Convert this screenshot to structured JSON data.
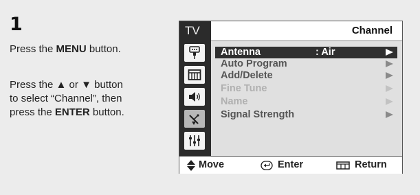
{
  "step": {
    "number": "1",
    "line1": {
      "pre": "Press the ",
      "bold": "MENU",
      "post": " button."
    },
    "block2": {
      "line1_pre": "Press the ",
      "up_arrow": "▲",
      "or": " or ",
      "down_arrow": "▼",
      "line1_post": " button",
      "line2": "to select “Channel”, then",
      "line3_pre": "press the ",
      "line3_bold": "ENTER",
      "line3_post": " button."
    }
  },
  "osd": {
    "side_title": "TV",
    "side_icons": [
      "input-icon",
      "picture-icon",
      "sound-icon",
      "channel-icon",
      "setup-icon"
    ],
    "active_side_icon": "channel-icon",
    "header_title": "Channel",
    "menu_items": [
      {
        "label": "Antenna",
        "value": ": Air",
        "state": "selected"
      },
      {
        "label": "Auto Program",
        "value": "",
        "state": "normal"
      },
      {
        "label": "Add/Delete",
        "value": "",
        "state": "normal"
      },
      {
        "label": "Fine Tune",
        "value": "",
        "state": "disabled"
      },
      {
        "label": "Name",
        "value": "",
        "state": "disabled"
      },
      {
        "label": "Signal Strength",
        "value": "",
        "state": "normal"
      }
    ],
    "footer": {
      "move": "Move",
      "enter": "Enter",
      "return": "Return"
    }
  },
  "colors": {
    "panel_bg": "#ececec",
    "osd_dark": "#2b2b2b",
    "menu_bg": "#e0e0e0",
    "selected_bg": "#2f2f2f",
    "disabled_text": "#b0b0b0"
  }
}
